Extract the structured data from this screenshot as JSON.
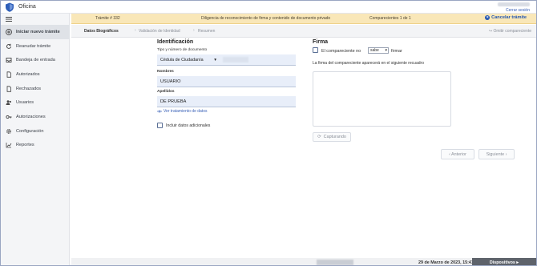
{
  "app": {
    "title": "Oficina",
    "logout_label": "Cerrar sesión"
  },
  "sidebar": {
    "items": [
      {
        "label": "Iniciar nuevo trámite",
        "icon": "plus-circle-icon",
        "active": true
      },
      {
        "label": "Reanudar trámite",
        "icon": "resume-icon"
      },
      {
        "label": "Bandeja de entrada",
        "icon": "inbox-icon"
      },
      {
        "label": "Autorizados",
        "icon": "document-icon"
      },
      {
        "label": "Rechazados",
        "icon": "document-icon"
      },
      {
        "label": "Usuarios",
        "icon": "users-icon"
      },
      {
        "label": "Autorizaciones",
        "icon": "key-icon"
      },
      {
        "label": "Configuración",
        "icon": "gear-icon"
      },
      {
        "label": "Reportes",
        "icon": "chart-icon"
      }
    ]
  },
  "notice": {
    "tramite": "Trámite # 332",
    "description": "Diligencia de reconocimiento de firma y contenido de documento privado",
    "comparecientes": "Comparecientes 1 de 1",
    "cancel_label": "Cancelar trámite"
  },
  "stepper": {
    "steps": [
      "Datos Biográficos",
      "Validación de Identidad",
      "Resumen"
    ],
    "omit_label": "Omitir compareciente"
  },
  "identificacion": {
    "title": "Identificación",
    "doc_label": "Tipo y número de documento",
    "doc_type": "Cédula de Ciudadanía",
    "nombres_label": "Nombres",
    "nombres_value": "USUARIO",
    "apellidos_label": "Apellidos",
    "apellidos_value": "DE PRUEBA",
    "treatment_link": "Ver tratamiento de datos",
    "additional_label": "Incluir datos adicionales"
  },
  "firma": {
    "title": "Firma",
    "compareciente_prefix": "El compareciente no",
    "sabe_option": "sabe",
    "firmar_suffix": "firmar",
    "helper": "La firma del compareciente aparecerá en el siguiente recuadro",
    "capture_label": "Capturando"
  },
  "nav_buttons": {
    "prev_label": "‹ Anterior",
    "next_label": "Siguiente ›"
  },
  "footer": {
    "datetime": "29 de Marzo de 2023, 15:41",
    "devices_label": "Dispositivos ▸"
  },
  "colors": {
    "accent": "#2456b0",
    "notice_bg": "#f9e7b8",
    "field_bg": "#e8eef9",
    "footer_dark": "#5e636b"
  }
}
